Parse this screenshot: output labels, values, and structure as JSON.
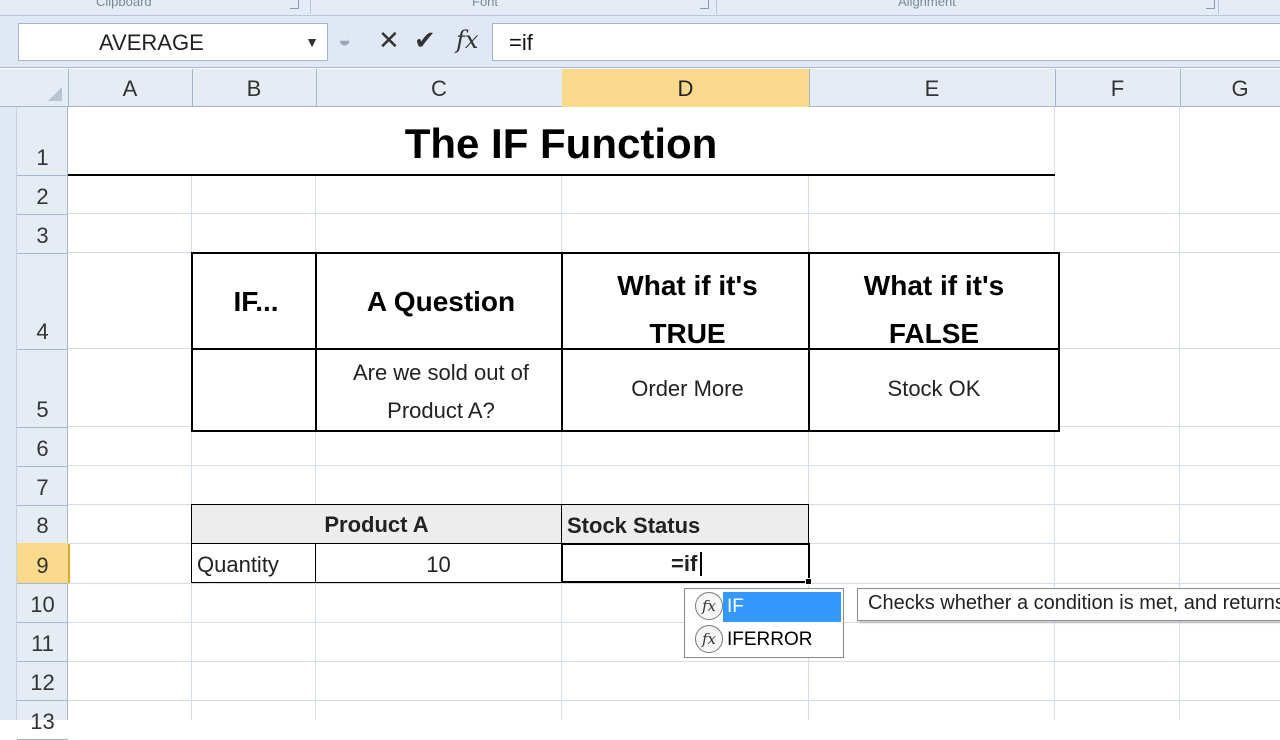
{
  "ribbon": {
    "groups": [
      "Clipboard",
      "Font",
      "Alignment"
    ]
  },
  "formula_bar": {
    "name_box": "AVERAGE",
    "cancel_icon": "✕",
    "enter_icon": "✔",
    "fx_icon": "fx",
    "formula": "=if"
  },
  "columns": [
    "A",
    "B",
    "C",
    "D",
    "E",
    "F",
    "G"
  ],
  "active_column": "D",
  "rows": [
    "1",
    "2",
    "3",
    "4",
    "5",
    "6",
    "7",
    "8",
    "9",
    "10",
    "11",
    "12",
    "13"
  ],
  "active_row": "9",
  "sheet": {
    "title": "The IF Function",
    "if_table": {
      "headers": [
        "IF...",
        "A Question",
        "What if it's TRUE",
        "What if it's FALSE"
      ],
      "row": [
        "",
        "Are we sold out of Product A?",
        "Order More",
        "Stock OK"
      ]
    },
    "stock_table": {
      "header_b": "",
      "header_c": "Product A",
      "header_d": "Stock Status",
      "row_label": "Quantity",
      "quantity": "10",
      "editing_value": "=if"
    }
  },
  "autocomplete": {
    "items": [
      "IF",
      "IFERROR"
    ],
    "selected": "IF",
    "tooltip": "Checks whether a condition is met, and returns one value if TRUE, and another value if FALSE"
  }
}
